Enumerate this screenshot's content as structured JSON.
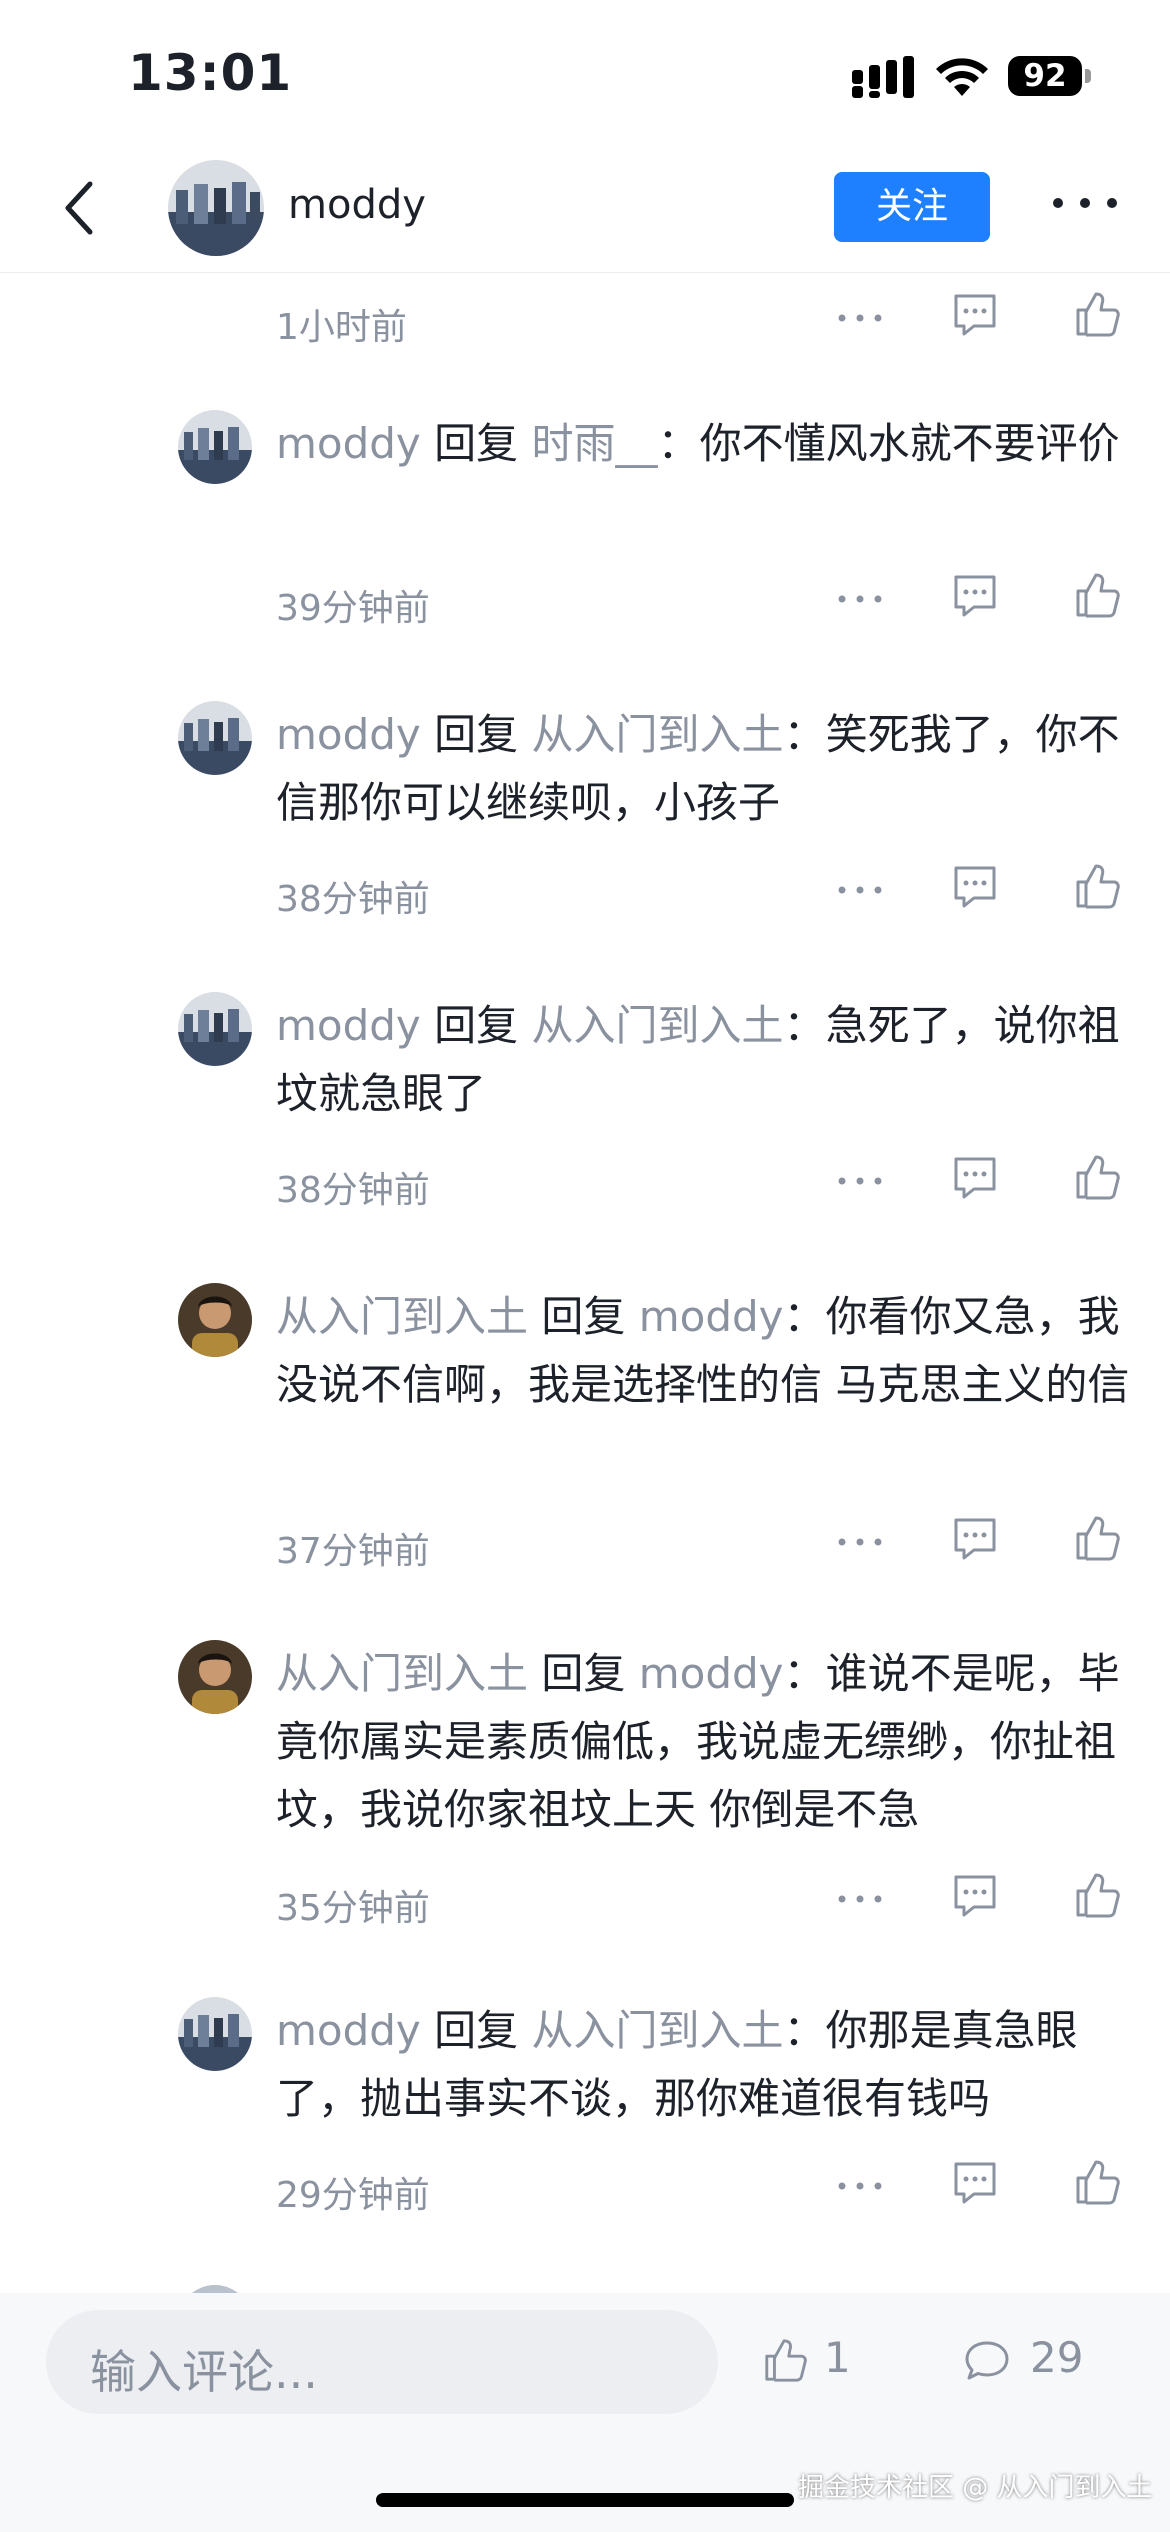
{
  "status_bar": {
    "time": "13:01",
    "battery": "92"
  },
  "header": {
    "username": "moddy",
    "follow_label": "关注"
  },
  "comments": [
    {
      "timestamp": "1小时前"
    },
    {
      "author": "moddy",
      "reply_word": "回复",
      "target": "时雨__",
      "sep": "：",
      "content": "你不懂风水就不要评价",
      "timestamp": "39分钟前"
    },
    {
      "author": "moddy",
      "reply_word": "回复",
      "target": "从入门到入土",
      "sep": "：",
      "content": "笑死我了，你不信那你可以继续呗，小孩子",
      "timestamp": "38分钟前"
    },
    {
      "author": "moddy",
      "reply_word": "回复",
      "target": "从入门到入土",
      "sep": "：",
      "content": "急死了，说你祖坟就急眼了",
      "timestamp": "38分钟前"
    },
    {
      "author": "从入门到入土",
      "reply_word": "回复",
      "target": "moddy",
      "sep": "：",
      "content": "你看你又急，我没说不信啊，我是选择性的信 马克思主义的信",
      "timestamp": "37分钟前"
    },
    {
      "author": "从入门到入土",
      "reply_word": "回复",
      "target": "moddy",
      "sep": "：",
      "content": "谁说不是呢，毕竟你属实是素质偏低，我说虚无缥缈，你扯祖坟，我说你家祖坟上天 你倒是不急",
      "timestamp": "35分钟前"
    },
    {
      "author": "moddy",
      "reply_word": "回复",
      "target": "从入门到入土",
      "sep": "：",
      "content": "你那是真急眼了，抛出事实不谈，那你难道很有钱吗",
      "timestamp": "29分钟前"
    }
  ],
  "bottom_bar": {
    "input_placeholder": "输入评论...",
    "like_count": "1",
    "comment_count": "29"
  },
  "watermark": "掘金技术社区 @ 从入门到入土",
  "icons": [
    "back-icon",
    "more-icon",
    "ellipsis-icon",
    "comment-icon",
    "thumb-up-icon"
  ],
  "colors": {
    "accent": "#1e80ff",
    "username_gray": "#8a919f",
    "text": "#1d2129"
  }
}
